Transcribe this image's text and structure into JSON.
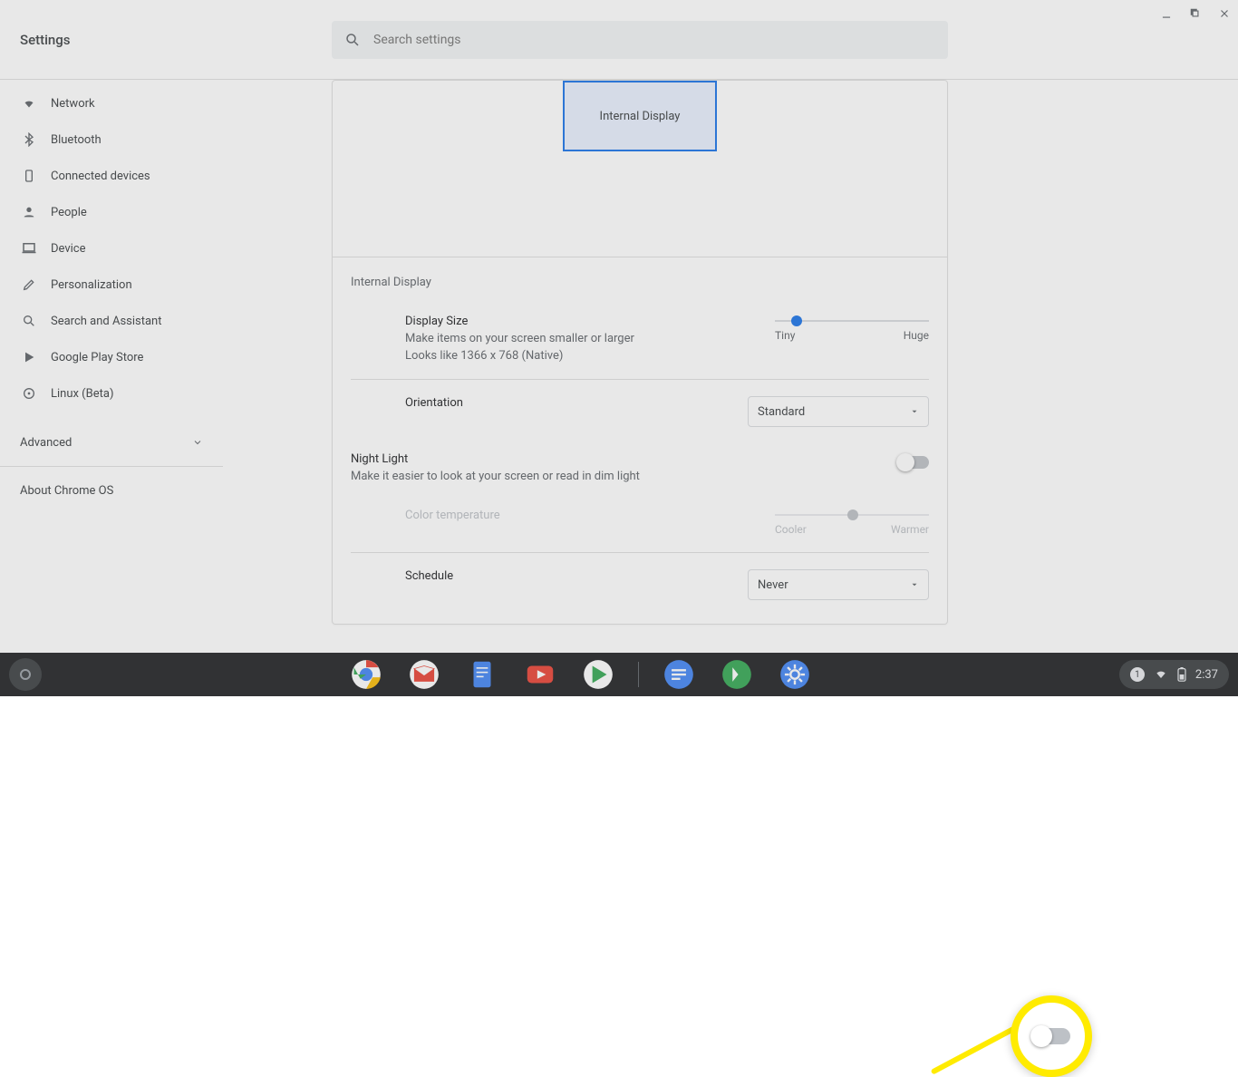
{
  "header": {
    "title": "Settings",
    "search_placeholder": "Search settings"
  },
  "sidebar": {
    "items": [
      {
        "label": "Network"
      },
      {
        "label": "Bluetooth"
      },
      {
        "label": "Connected devices"
      },
      {
        "label": "People"
      },
      {
        "label": "Device"
      },
      {
        "label": "Personalization"
      },
      {
        "label": "Search and Assistant"
      },
      {
        "label": "Google Play Store"
      },
      {
        "label": "Linux (Beta)"
      }
    ],
    "advanced": "Advanced",
    "about": "About Chrome OS"
  },
  "display": {
    "preview_label": "Internal Display",
    "section_title": "Internal Display",
    "size": {
      "title": "Display Size",
      "sub1": "Make items on your screen smaller or larger",
      "sub2": "Looks like 1366 x 768 (Native)",
      "min_label": "Tiny",
      "max_label": "Huge"
    },
    "orientation": {
      "title": "Orientation",
      "value": "Standard"
    },
    "night_light": {
      "title": "Night Light",
      "sub": "Make it easier to look at your screen or read in dim light",
      "enabled": false,
      "color_temp_label": "Color temperature",
      "color_min": "Cooler",
      "color_max": "Warmer",
      "schedule_label": "Schedule",
      "schedule_value": "Never"
    }
  },
  "tray": {
    "notifications": "1",
    "time": "2:37"
  }
}
